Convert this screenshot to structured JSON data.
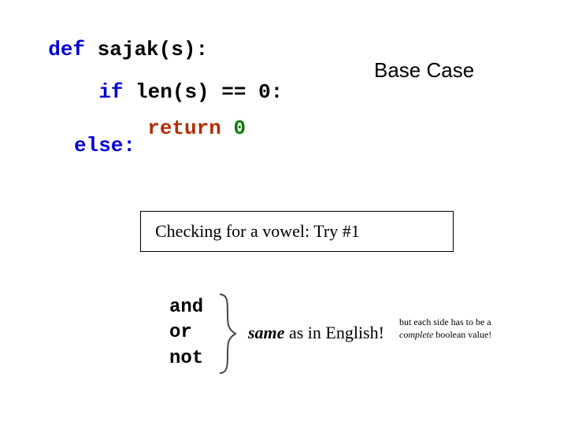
{
  "code": {
    "def_kw": "def",
    "def_rest": " sajak(s):",
    "if_kw": "if",
    "if_rest": " len(s) == 0:",
    "return_kw": "return",
    "return_sp": " ",
    "return_val": "0",
    "else_line": "else:"
  },
  "base_case_label": "Base Case",
  "vowel_box": "Checking for a vowel:  Try #1",
  "ops": {
    "and": "and",
    "or": "or",
    "not": "not"
  },
  "same_english": {
    "same": "same",
    "rest": " as in English!"
  },
  "tiny_note": {
    "l1_a": "but each side has to be a",
    "l2_complete": "complete",
    "l2_rest": " boolean value!"
  }
}
